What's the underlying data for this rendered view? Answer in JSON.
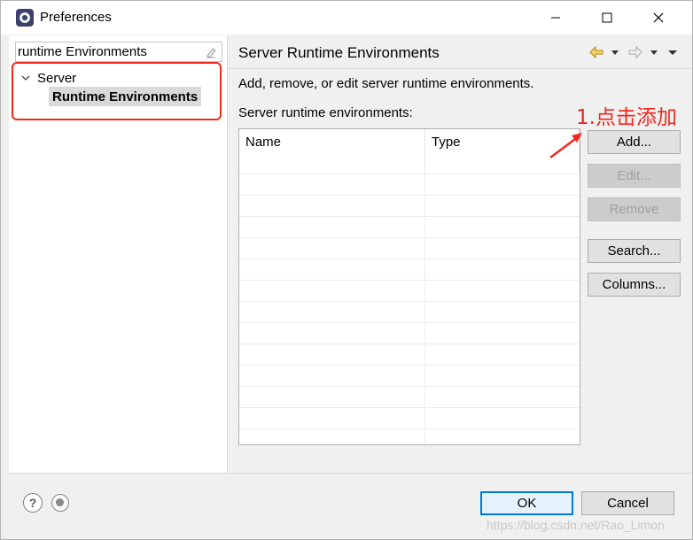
{
  "window": {
    "title": "Preferences"
  },
  "left": {
    "filter_value": "runtime Environments",
    "tree": {
      "server_label": "Server",
      "runtime_label": "Runtime Environments"
    }
  },
  "right": {
    "title": "Server Runtime Environments",
    "description": "Add, remove, or edit server runtime environments.",
    "list_label": "Server runtime environments:",
    "table": {
      "columns": [
        "Name",
        "Type"
      ],
      "rows": []
    },
    "buttons": {
      "add": "Add...",
      "edit": "Edit...",
      "remove": "Remove",
      "search": "Search...",
      "columns": "Columns..."
    },
    "annotation": "1.点击添加"
  },
  "footer": {
    "help_icon": "question-mark",
    "ok": "OK",
    "cancel": "Cancel",
    "watermark": "https://blog.csdn.net/Rao_Limon"
  },
  "colors": {
    "annotation": "#f0281e",
    "ok_border": "#0078d7"
  }
}
